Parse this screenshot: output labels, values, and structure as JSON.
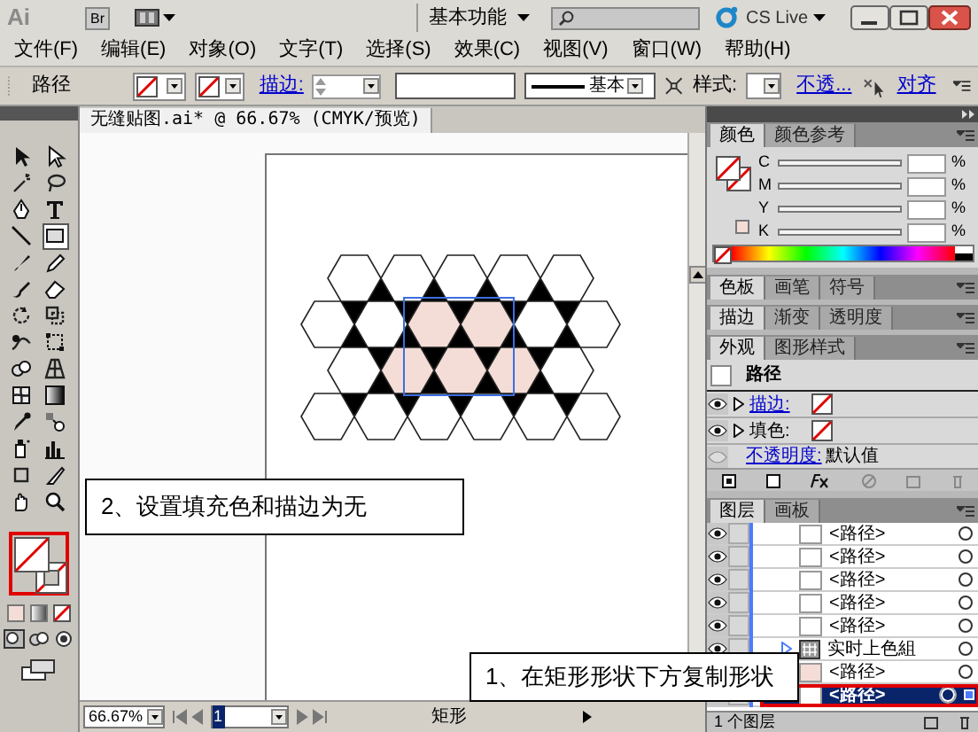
{
  "title_bar": {
    "logo": "Ai",
    "bridge": "Br",
    "workspace": "基本功能",
    "cs_live": "CS Live"
  },
  "menu": [
    "文件(F)",
    "编辑(E)",
    "对象(O)",
    "文字(T)",
    "选择(S)",
    "效果(C)",
    "视图(V)",
    "窗口(W)",
    "帮助(H)"
  ],
  "selection_style": {
    "fill_none": true,
    "stroke_none": true
  },
  "control_bar": {
    "object": "路径",
    "stroke_label": "描边:",
    "brush": "基本",
    "style_label": "样式:",
    "opacity_link": "不透...",
    "align_link": "对齐"
  },
  "document_tab": {
    "title": "无缝贴图.ai* @ 66.67% (CMYK/预览)"
  },
  "status_bar": {
    "zoom": "66.67%",
    "artboard": "1",
    "tool": "矩形"
  },
  "callouts": [
    {
      "text": "2、设置填充色和描边为无"
    },
    {
      "text": "1、在矩形形状下方复制形状"
    }
  ],
  "color_panel": {
    "tabs": [
      {
        "label": "颜色",
        "selected": true
      },
      {
        "label": "颜色参考",
        "selected": false
      }
    ],
    "channels": [
      {
        "name": "C",
        "unit": "%"
      },
      {
        "name": "M",
        "unit": "%"
      },
      {
        "name": "Y",
        "unit": "%"
      },
      {
        "name": "K",
        "unit": "%"
      }
    ]
  },
  "swatches_tabs": [
    {
      "label": "色板",
      "selected": true
    },
    {
      "label": "画笔",
      "selected": false
    },
    {
      "label": "符号",
      "selected": false
    }
  ],
  "stroke_tabs": [
    {
      "label": "描边",
      "selected": true
    },
    {
      "label": "渐变",
      "selected": false
    },
    {
      "label": "透明度",
      "selected": false
    }
  ],
  "appearance": {
    "tabs": [
      {
        "label": "外观",
        "selected": true
      },
      {
        "label": "图形样式",
        "selected": false
      }
    ],
    "title": "路径",
    "rows": [
      {
        "kind": "stroke",
        "label": "描边:"
      },
      {
        "kind": "fill",
        "label": "填色:"
      }
    ],
    "opacity_label": "不透明度:",
    "opacity_value": "默认值"
  },
  "layers": {
    "tabs": [
      {
        "label": "图层",
        "selected": true
      },
      {
        "label": "画板",
        "selected": false
      }
    ],
    "rows": [
      {
        "kind": "path",
        "name": "<路径>",
        "color": "#ffffff",
        "selected": false
      },
      {
        "kind": "path",
        "name": "<路径>",
        "color": "#ffffff",
        "selected": false
      },
      {
        "kind": "path",
        "name": "<路径>",
        "color": "#ffffff",
        "selected": false
      },
      {
        "kind": "path",
        "name": "<路径>",
        "color": "#ffffff",
        "selected": false
      },
      {
        "kind": "path",
        "name": "<路径>",
        "color": "#ffffff",
        "selected": false
      },
      {
        "kind": "group",
        "name": "实时上色組",
        "selected": false
      },
      {
        "kind": "path",
        "name": "<路径>",
        "color": "#f4ddd6",
        "selected": false
      },
      {
        "kind": "path",
        "name": "<路径>",
        "color": "#ffffff",
        "selected": true
      }
    ],
    "footer": "1 个图层"
  }
}
